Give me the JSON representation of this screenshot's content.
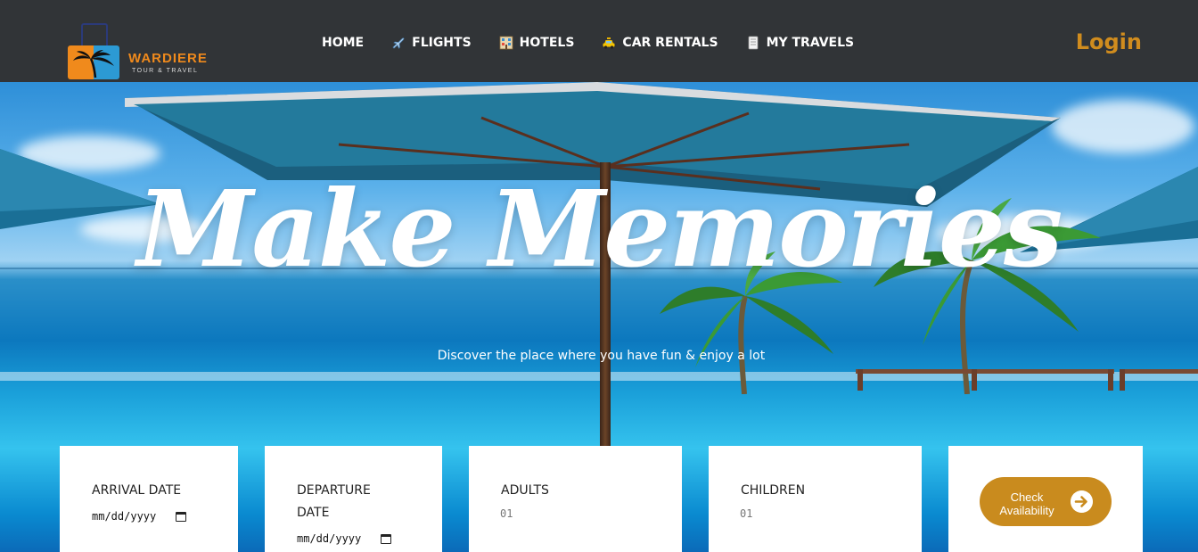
{
  "brand": {
    "name": "WARDIERE",
    "subtitle": "TOUR & TRAVEL"
  },
  "nav": {
    "items": [
      {
        "label": "HOME",
        "icon": ""
      },
      {
        "label": "FLIGHTS",
        "icon": "airplane-icon"
      },
      {
        "label": "HOTELS",
        "icon": "hotel-icon"
      },
      {
        "label": "CAR RENTALS",
        "icon": "taxi-icon"
      },
      {
        "label": "MY TRAVELS",
        "icon": "scroll-icon"
      }
    ],
    "login": "Login"
  },
  "hero": {
    "headline": "Make Memories",
    "tagline": "Discover the place where you have fun & enjoy a lot"
  },
  "booking": {
    "arrival": {
      "label": "ARRIVAL DATE",
      "value": "mm/dd/yyyy"
    },
    "departure": {
      "label": "DEPARTURE DATE",
      "value": "mm/dd/yyyy"
    },
    "adults": {
      "label": "ADULTS",
      "placeholder": "01"
    },
    "children": {
      "label": "CHILDREN",
      "placeholder": "01"
    },
    "check_button": "Check Availability"
  },
  "colors": {
    "accent": "#c98b1e",
    "navbar": "#313437",
    "brand_orange": "#f08a1c",
    "brand_blue": "#2c9ad4"
  }
}
